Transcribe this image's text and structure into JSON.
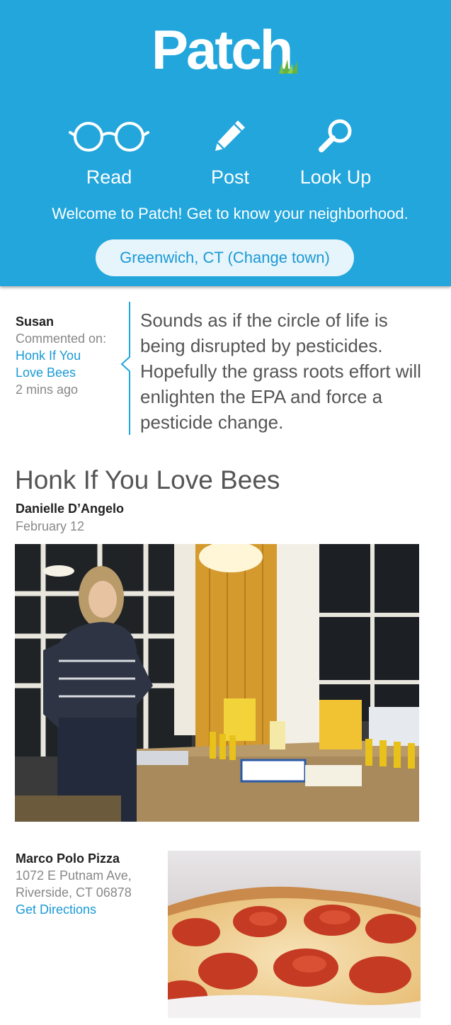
{
  "header": {
    "logo_text": "Patch",
    "nav": [
      {
        "label": "Read",
        "icon": "glasses-icon"
      },
      {
        "label": "Post",
        "icon": "pencil-icon"
      },
      {
        "label": "Look Up",
        "icon": "search-icon"
      }
    ],
    "welcome_text": "Welcome to Patch! Get to know your neighborhood.",
    "town_button": "Greenwich, CT (Change town)",
    "background_color": "#22a6dc"
  },
  "comment": {
    "user": "Susan",
    "action": "Commented on:",
    "article_link": "Honk If You Love Bees",
    "time": "2 mins ago",
    "text": "Sounds as if the circle of life is being disrupted by pesticides. Hopefully the grass roots effort will enlighten the EPA and force a pesticide change."
  },
  "article": {
    "title": "Honk If You Love Bees",
    "author": "Danielle D’Angelo",
    "date": "February 12"
  },
  "place": {
    "name": "Marco Polo Pizza",
    "address_line1": "1072 E Putnam Ave,",
    "address_line2": "Riverside, CT 06878",
    "directions_link": "Get Directions"
  },
  "colors": {
    "accent": "#1a9ad6",
    "muted_text": "#888888"
  }
}
